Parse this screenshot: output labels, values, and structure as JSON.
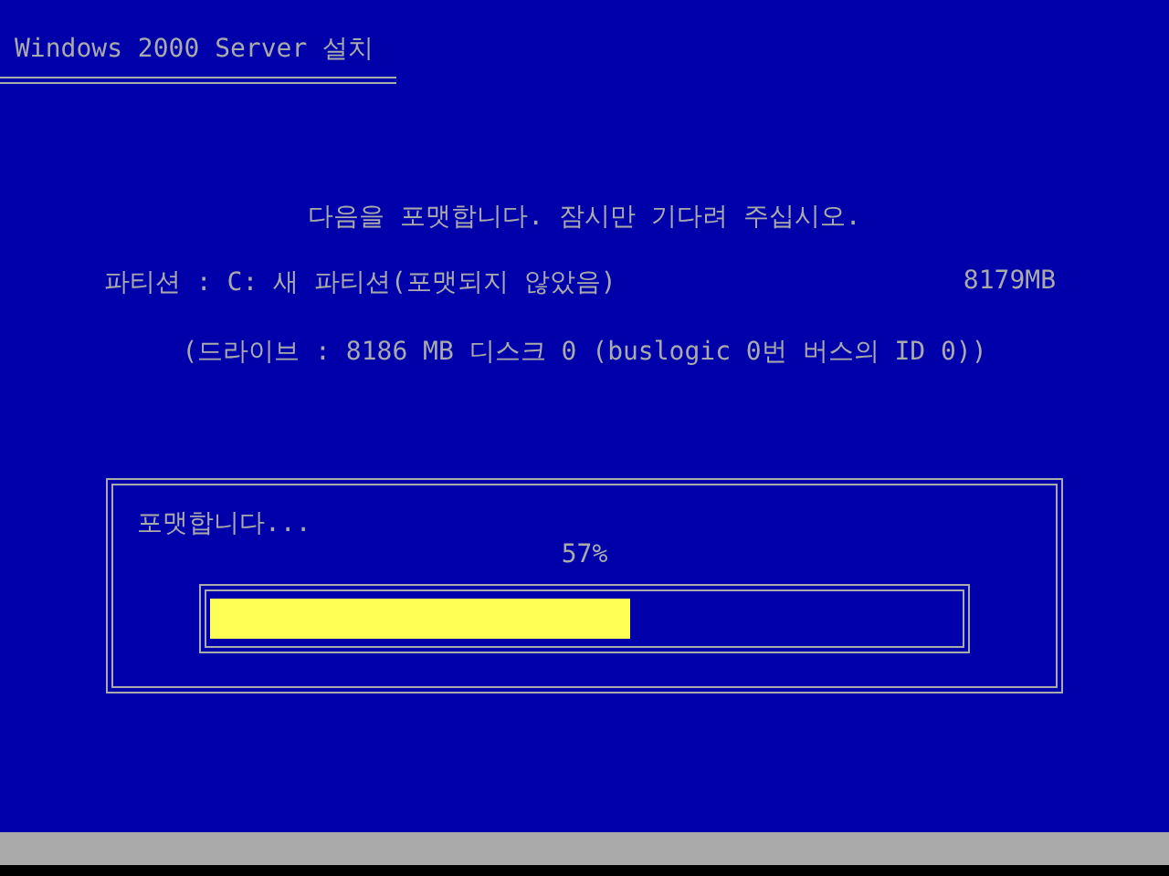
{
  "window": {
    "title": "Windows 2000 Server 설치"
  },
  "message": "다음을 포맷합니다. 잠시만 기다려 주십시오.",
  "partition": {
    "label": "파티션 : C: 새 파티션(포맷되지 않았음)",
    "size": "8179MB"
  },
  "drive": "(드라이브 : 8186 MB 디스크 0 (buslogic 0번 버스의 ID 0))",
  "progress": {
    "title": "포맷합니다...",
    "percent": "57%",
    "level": 0.56
  }
}
